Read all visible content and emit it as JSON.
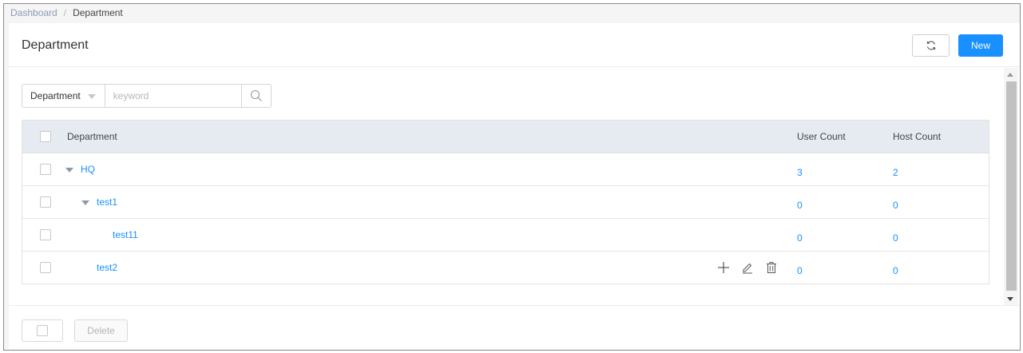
{
  "breadcrumb": {
    "root": "Dashboard",
    "separator": "/",
    "current": "Department"
  },
  "page": {
    "title": "Department",
    "new_label": "New",
    "refresh_icon": "refresh-icon"
  },
  "search": {
    "field": "Department",
    "placeholder": "keyword",
    "value": ""
  },
  "table": {
    "columns": {
      "name": "Department",
      "users": "User Count",
      "hosts": "Host Count"
    },
    "rows": [
      {
        "name": "HQ",
        "users": "3",
        "hosts": "2",
        "level": 0,
        "expanded": true
      },
      {
        "name": "test1",
        "users": "0",
        "hosts": "0",
        "level": 1,
        "expanded": true
      },
      {
        "name": "test11",
        "users": "0",
        "hosts": "0",
        "level": 2
      },
      {
        "name": "test2",
        "users": "0",
        "hosts": "0",
        "level": 1,
        "actions": [
          "add-icon",
          "edit-icon",
          "delete-icon"
        ]
      }
    ]
  },
  "footer": {
    "delete_label": "Delete"
  },
  "colors": {
    "accent": "#1890ff",
    "header_bg": "#e6ebf2"
  }
}
